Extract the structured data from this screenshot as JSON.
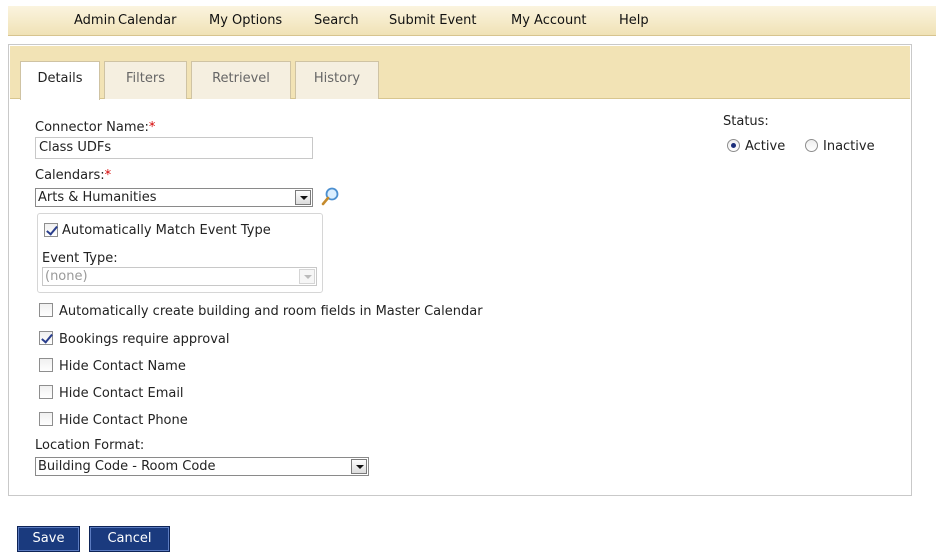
{
  "menu": [
    "Admin",
    "Calendar",
    "My Options",
    "Search",
    "Submit Event",
    "My Account",
    "Help"
  ],
  "tabs": [
    "Details",
    "Filters",
    "Retrievel",
    "History"
  ],
  "form": {
    "connector_name_label": "Connector Name:",
    "required_mark": "*",
    "connector_name_value": "Class UDFs",
    "calendars_label": "Calendars:",
    "calendars_value": "Arts & Humanities",
    "auto_match_label": "Automatically Match Event Type",
    "auto_match_checked": true,
    "event_type_label": "Event Type:",
    "event_type_value": "(none)",
    "options": [
      {
        "label": "Automatically create building and room fields in Master Calendar",
        "checked": false
      },
      {
        "label": "Bookings require approval",
        "checked": true
      },
      {
        "label": "Hide Contact Name",
        "checked": false
      },
      {
        "label": "Hide Contact Email",
        "checked": false
      },
      {
        "label": "Hide Contact Phone",
        "checked": false
      }
    ],
    "location_format_label": "Location Format:",
    "location_format_value": "Building Code - Room Code"
  },
  "status": {
    "label": "Status:",
    "active_label": "Active",
    "inactive_label": "Inactive",
    "selected": "Active"
  },
  "buttons": {
    "save": "Save",
    "cancel": "Cancel"
  },
  "colors": {
    "menubar": "#f0e2b6",
    "tabstrip": "#f2e3b5",
    "button": "#1a3a7e",
    "required": "#d40000"
  },
  "icons": {
    "calendar_lookup": "magnifier-icon"
  }
}
